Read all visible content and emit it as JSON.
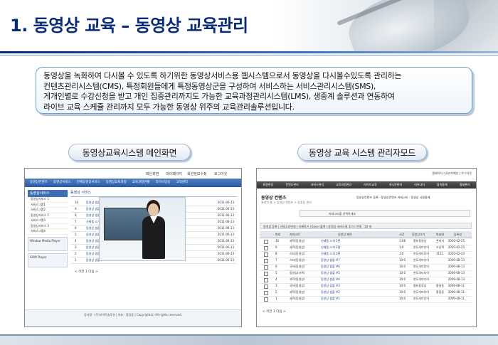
{
  "slide": {
    "title": "1. 동영상 교육 – 동영상 교육관리",
    "description": [
      "동영상을 녹화하여 다시볼 수 있도록 하기위한 동영상서비스용 웹시스템으로서 동영상을 다시볼수있도록 관리하는",
      "컨텐츠관리시스템(CMS), 특정회원들에게 특정동영상군을 구성하여 서비스하는 서비스관리시스템(SMS),",
      "게개인별로 수강신청을 받고 개인 집중관리까지도 가능한 교육과정관리시스템(LMS), 생중계 솔루션과 연동하여",
      "라이브 교육 스케쥴 관리까지 모두 가능한 동영상 위주의 교육관리솔루션입니다."
    ],
    "caption_left": "동영상교육시스템 메인화면",
    "caption_right": "동영상 교육 시스템 관리자모드"
  },
  "left_shot": {
    "top_links": [
      "메인화면",
      "마이페이지",
      "회원정보수정",
      "로그아웃"
    ],
    "nav": [
      "동영상컨텐츠",
      "동영상서비스",
      "전체동영상서비스",
      "동영상교육과정",
      "교육과정현황",
      "라이브방송",
      "고객센터"
    ],
    "side_header": "동영상서비스",
    "side_items": [
      "동영상서비스 1",
      "서비스그룹1",
      "서비스그룹2",
      "동영상서비스 2",
      "서비스그룹3",
      "동영상서비스 3",
      "서비스그룹4"
    ],
    "player_box": "Window Media Player",
    "player_box2": "GOM Player",
    "main_header": "동영상 서비스",
    "rows": [
      {
        "n": "10",
        "t": "동영상 샘플 10",
        "d": "2011-06-13"
      },
      {
        "n": "9",
        "t": "동영상 샘플 9",
        "d": "2011-06-13"
      },
      {
        "n": "8",
        "t": "동영상 샘플 8",
        "d": "2011-06-13"
      },
      {
        "n": "7",
        "t": "신제품 소개",
        "d": "2011-06-13"
      },
      {
        "n": "6",
        "t": "동영상 샘플 6",
        "d": "2011-06-13"
      },
      {
        "n": "5",
        "t": "동영상 샘플 5",
        "d": "2011-06-13"
      },
      {
        "n": "4",
        "t": "동영상 샘플 4",
        "d": "2011-06-13"
      },
      {
        "n": "3",
        "t": "동영상 샘플 3",
        "d": "2011-06-13"
      },
      {
        "n": "2",
        "t": "동영상 샘플 2",
        "d": "2011-06-13"
      },
      {
        "n": "1",
        "t": "동영상 샘플 1",
        "d": "2011-06-13"
      }
    ],
    "pager": "< 이전 1 다음 >",
    "footer": "동사명 : (주)사이트솔루션 | 대표 : 홍길동 | Copyright(c) All rights reserved."
  },
  "right_shot": {
    "top_links": "홈페이지 | 관리자메인 | 로그아웃",
    "nav": [
      "회원관리",
      "컨텐츠관리",
      "서비스관리",
      "교육과정관리",
      "라이브교육",
      "게시판관리",
      "커뮤니티",
      "접속통계",
      "결제관리"
    ],
    "title": "동영상 컨텐츠",
    "breadcrumb": "관리자 홈 > 동영상 컨텐츠 > 동영상 관리",
    "tabs": "동영상컨텐츠 등록 · 동영상컨텐츠 카테고리 · 동영상 사용통계",
    "search": "카테고리를 선택하세요",
    "toolbar": "동영상 등록 | 카테고리변경 | 삭제하기 | Excel 출력 | 동영상 서비스에 추가 | 전체 : 10 개",
    "header": [
      "번호",
      "카테고리",
      "동영상 제목",
      "시간",
      "동영상크기",
      "파일명",
      "등록일"
    ],
    "rows": [
      {
        "n": "10",
        "cat": "과학(동영상)",
        "title": "신제품 소개 1편",
        "time": "1:08",
        "size": "홍보동영상",
        "who": "관리자",
        "date": "2010-02-25"
      },
      {
        "n": "9",
        "cat": "과학(동영상)",
        "title": "신제품 소개 2편",
        "time": "1:0",
        "size": "한도의미디어",
        "who": "조상혁",
        "date": "2010-02-25"
      },
      {
        "n": "8",
        "cat": "스타(동영상)",
        "title": "신제품 소개 3편",
        "time": "1:0",
        "size": "한도의미디어",
        "who": "1111",
        "date": "2010-02-23"
      },
      {
        "n": "7",
        "cat": "스타(동영상)",
        "title": "동영상 샘플 #7",
        "time": "10:0",
        "size": "한도의미디어",
        "who": "",
        "date": "2009-08-13"
      },
      {
        "n": "6",
        "cat": "국어(동영상)",
        "title": "동영상 샘플 #6",
        "time": "10:0",
        "size": "한도의미디어",
        "who": "",
        "date": "2009-08-13"
      },
      {
        "n": "5",
        "cat": "동영상(기록)",
        "title": "동영상 샘플 #5",
        "time": "10:0",
        "size": "한도의미디어",
        "who": "",
        "date": "2009-08-13"
      },
      {
        "n": "4",
        "cat": "과학(동영상)",
        "title": "동영상 샘플 #4",
        "time": "10:0",
        "size": "한도의미디어",
        "who": "",
        "date": "2009-08-13"
      },
      {
        "n": "3",
        "cat": "국어(동영상)",
        "title": "동영상 샘플 #3",
        "time": "10:0",
        "size": "홍보동영상",
        "who": "홍길동",
        "date": "2009-08-11"
      },
      {
        "n": "2",
        "cat": "과학(동영상)",
        "title": "동영상 샘플 #2",
        "time": "10:0",
        "size": "한도의미디어",
        "who": "홍길동",
        "date": "2009-08-11"
      },
      {
        "n": "1",
        "cat": "과학(동영상)",
        "title": "동영상 샘플 #1",
        "time": "10:0",
        "size": "한도의미디어",
        "who": "",
        "date": "2009-08-11"
      }
    ],
    "pager": "< 이전 1 다음 >"
  }
}
